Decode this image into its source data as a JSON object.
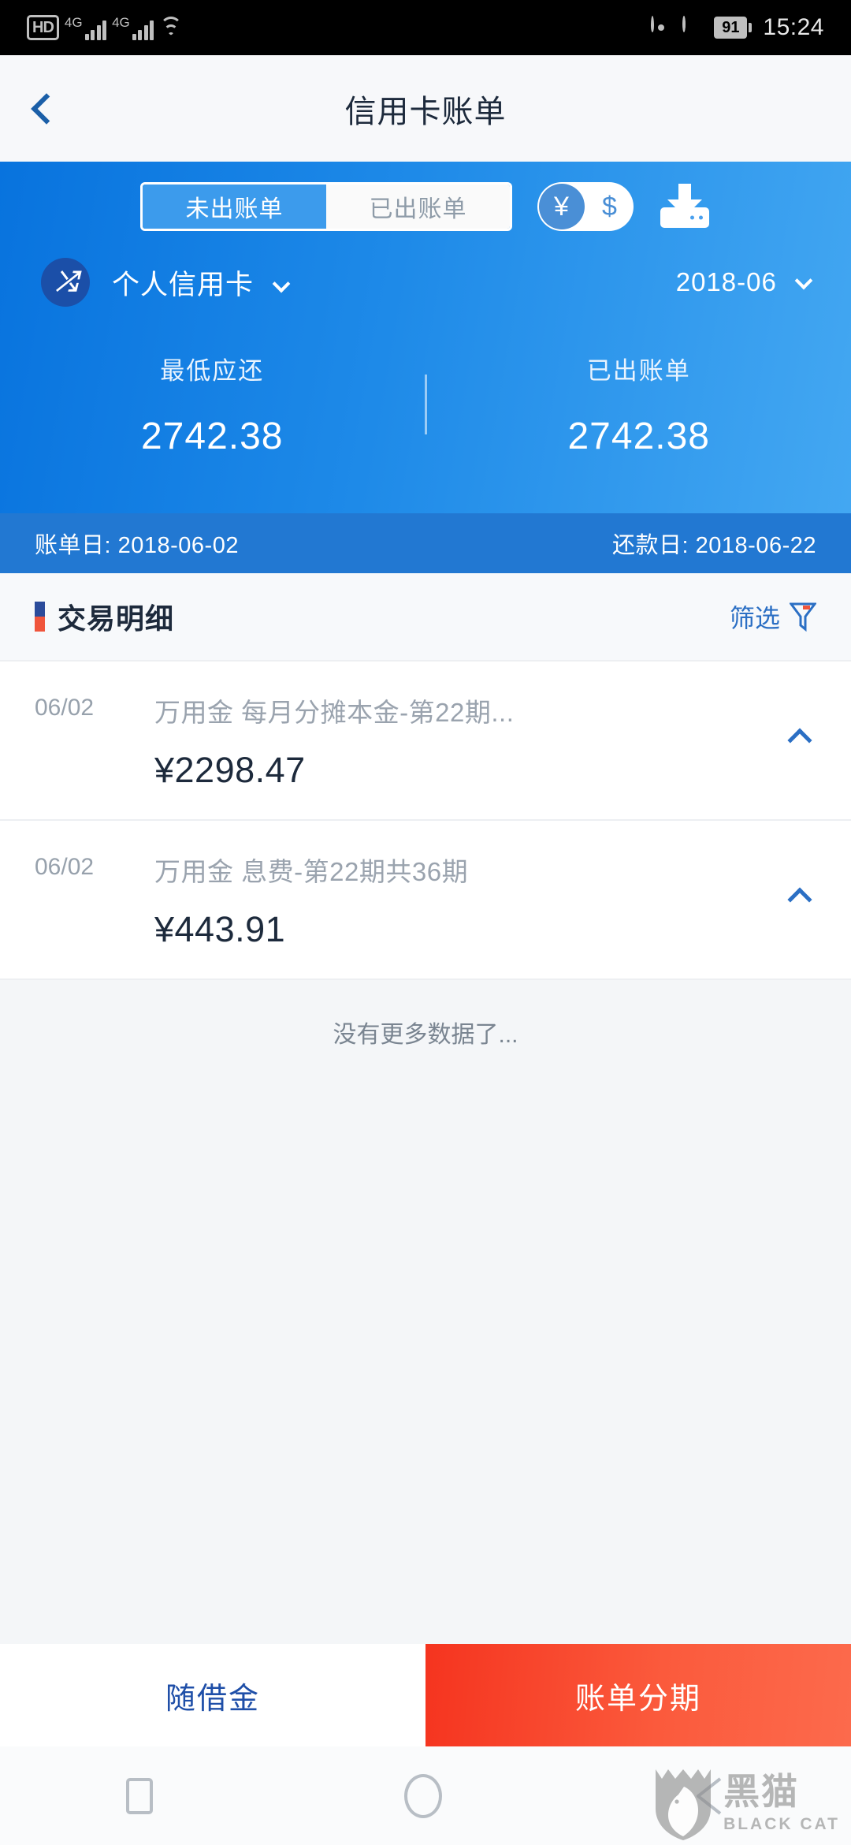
{
  "status_bar": {
    "hd_label": "HD",
    "sim1_network": "4G",
    "sim2_network": "4G",
    "battery_level": "91",
    "time": "15:24"
  },
  "nav_header": {
    "title": "信用卡账单",
    "back_icon": "back-chevron-icon"
  },
  "hero": {
    "tabs": [
      {
        "label": "未出账单",
        "active": true
      },
      {
        "label": "已出账单",
        "active": false
      }
    ],
    "currency_toggle": {
      "selected": "¥",
      "options": [
        "¥",
        "$"
      ]
    },
    "download_icon": "download-icon",
    "card": {
      "logo": "spd-bank-logo",
      "name": "个人信用卡",
      "dropdown_icon": "chevron-down-icon"
    },
    "month": {
      "value": "2018-06",
      "dropdown_icon": "chevron-down-icon"
    },
    "summary": [
      {
        "label": "最低应还",
        "value": "2742.38"
      },
      {
        "label": "已出账单",
        "value": "2742.38"
      }
    ],
    "dates": {
      "statement_date": "账单日: 2018-06-02",
      "due_date": "还款日: 2018-06-22"
    }
  },
  "transactions": {
    "section_title": "交易明细",
    "filter_label": "筛选",
    "filter_icon": "funnel-icon",
    "rows": [
      {
        "date": "06/02",
        "description": "万用金 每月分摊本金-第22期...",
        "amount": "¥2298.47",
        "chevron_icon": "chevron-right-icon"
      },
      {
        "date": "06/02",
        "description": "万用金 息费-第22期共36期",
        "amount": "¥443.91",
        "chevron_icon": "chevron-right-icon"
      }
    ],
    "end_text": "没有更多数据了..."
  },
  "bottom_actions": [
    {
      "label": "随借金",
      "style": "secondary"
    },
    {
      "label": "账单分期",
      "style": "primary"
    }
  ],
  "android_nav": {
    "recents_icon": "square-recents-icon",
    "home_icon": "circle-home-icon",
    "back_icon": "triangle-back-icon"
  },
  "watermark": {
    "cn": "黑猫",
    "en": "BLACK CAT",
    "logo_icon": "black-cat-shield-icon"
  },
  "colors": {
    "hero_gradient_start": "#0873DE",
    "hero_gradient_end": "#44A8F2",
    "date_bar": "#2278D2",
    "accent_blue": "#2B4C9B",
    "accent_red": "#F0553C",
    "primary_button": "#F5341F",
    "link_blue": "#2B6FC4"
  }
}
